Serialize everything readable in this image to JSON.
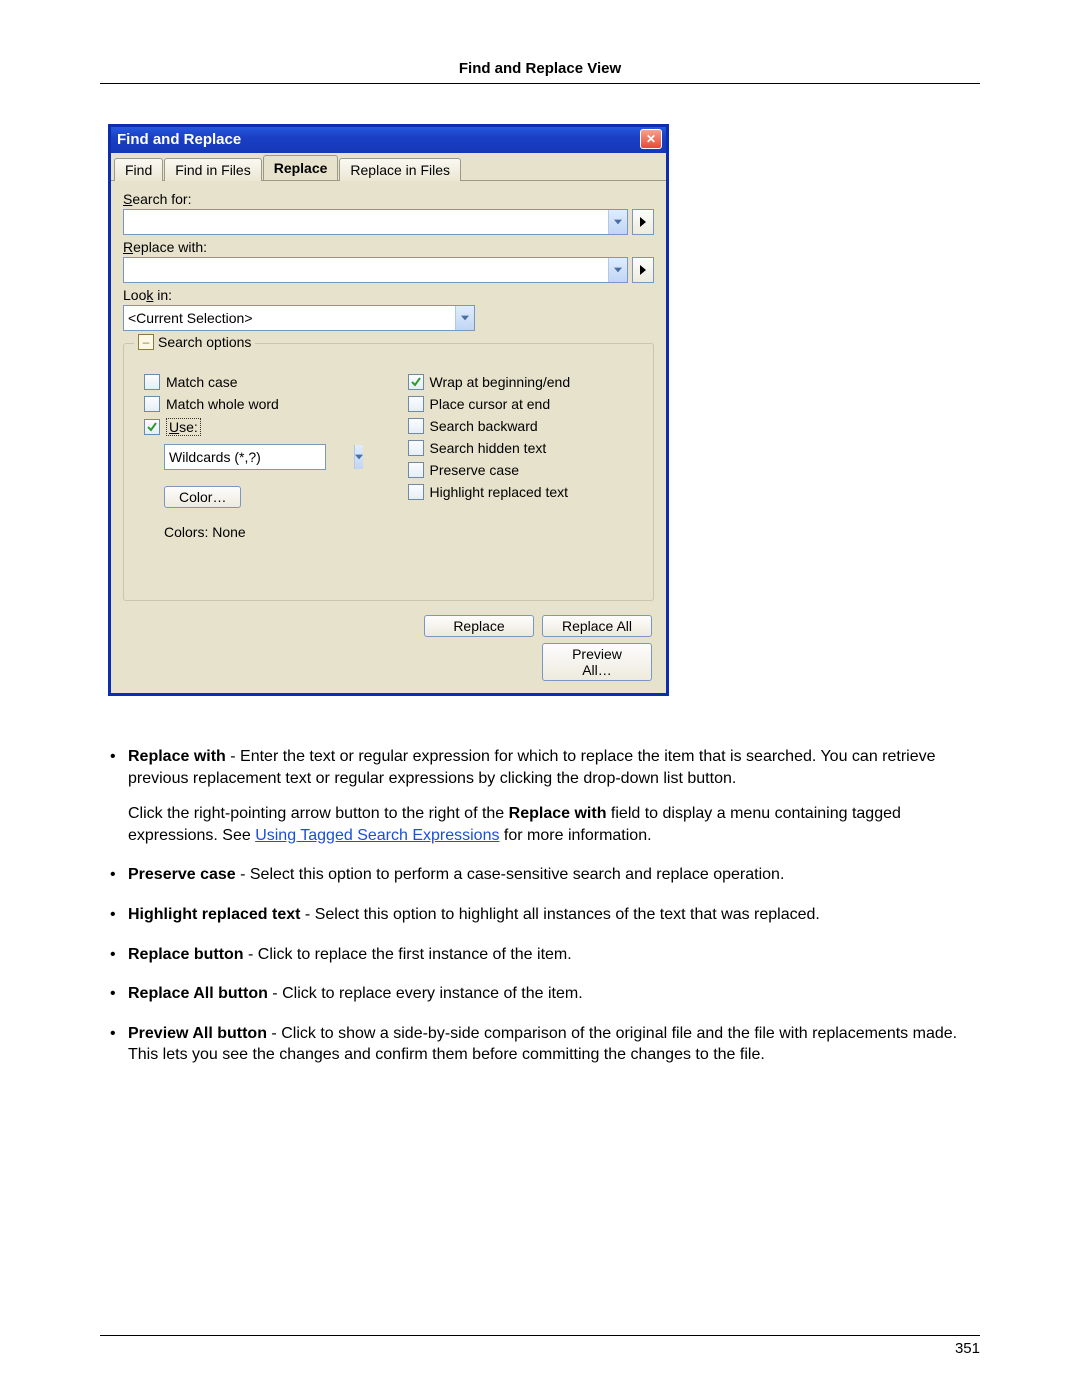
{
  "header": {
    "title": "Find and Replace View"
  },
  "page_number": "351",
  "dialog": {
    "title": "Find and Replace",
    "close_label": "✕",
    "tabs": [
      {
        "label": "Find",
        "active": false
      },
      {
        "label": "Find in Files",
        "active": false
      },
      {
        "label": "Replace",
        "active": true
      },
      {
        "label": "Replace in Files",
        "active": false
      }
    ],
    "search_for": {
      "label_pre": "",
      "label_u": "S",
      "label_post": "earch for:",
      "value": ""
    },
    "replace_with": {
      "label_pre": "",
      "label_u": "R",
      "label_post": "eplace with:",
      "value": ""
    },
    "look_in": {
      "label_pre": "Loo",
      "label_u": "k",
      "label_post": " in:",
      "value": "<Current Selection>"
    },
    "group_legend": "Search options",
    "collapse_glyph": "–",
    "options_left": {
      "match_case": "Match case",
      "match_whole_word": "Match whole word",
      "use_pre": "",
      "use_u": "U",
      "use_post": "se:",
      "use_dropdown_value": "Wildcards (*,?)",
      "color_button": "Color…",
      "colors_line": "Colors: None"
    },
    "options_right": {
      "wrap": "Wrap at beginning/end",
      "place_cursor": "Place cursor at end",
      "search_backward": "Search backward",
      "search_hidden": "Search hidden text",
      "preserve_case": "Preserve case",
      "highlight_replaced": "Highlight replaced text"
    },
    "footer": {
      "replace": "Replace",
      "replace_all": "Replace All",
      "preview_all": "Preview All…"
    }
  },
  "prose": {
    "items": [
      {
        "bold": "Replace with",
        "text1": " - Enter the text or regular expression for which to replace the item that is searched. You can retrieve previous replacement text or regular expressions by clicking the drop-down list button.",
        "sub_pre": "Click the right-pointing arrow button to the right of the ",
        "sub_bold": "Replace with",
        "sub_mid": " field to display a menu containing tagged expressions. See ",
        "sub_link": "Using Tagged Search Expressions",
        "sub_post": " for more information."
      },
      {
        "bold": "Preserve case",
        "text1": " - Select this option to perform a case-sensitive search and replace operation."
      },
      {
        "bold": "Highlight replaced text",
        "text1": " - Select this option to highlight all instances of the text that was replaced."
      },
      {
        "bold": "Replace button",
        "text1": " - Click to replace the first instance of the item."
      },
      {
        "bold": "Replace All button",
        "text1": " - Click to replace every instance of the item."
      },
      {
        "bold": "Preview All button",
        "text1": " - Click to show a side-by-side comparison of the original file and the file with replacements made. This lets you see the changes and confirm them before committing the changes to the file."
      }
    ]
  }
}
